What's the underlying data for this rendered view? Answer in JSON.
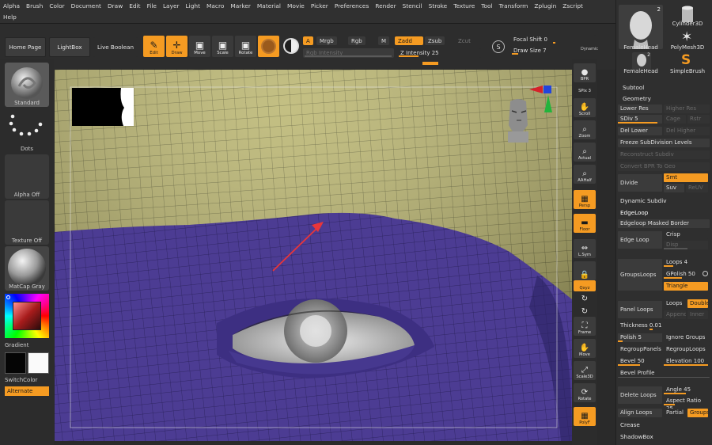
{
  "menu": {
    "row1": [
      "Alpha",
      "Brush",
      "Color",
      "Document",
      "Draw",
      "Edit",
      "File",
      "Layer",
      "Light",
      "Macro",
      "Marker",
      "Material",
      "Movie",
      "Picker",
      "Preferences",
      "Render",
      "Stencil",
      "Stroke",
      "Texture",
      "Tool",
      "Transform",
      "Zplugin",
      "Zscript"
    ],
    "row2": "Help"
  },
  "topshelf": {
    "home_page": "Home Page",
    "lightbox": "LightBox",
    "live_boolean": "Live Boolean",
    "tools": [
      {
        "label": "Edit",
        "icon": "edit-icon",
        "glyph": "✎",
        "active": true
      },
      {
        "label": "Draw",
        "icon": "draw-icon",
        "glyph": "✛",
        "active": true
      },
      {
        "label": "Move",
        "icon": "move-icon",
        "glyph": "▣",
        "active": false
      },
      {
        "label": "Scale",
        "icon": "scale-icon",
        "glyph": "▣",
        "active": false
      },
      {
        "label": "Rotate",
        "icon": "rotate-icon",
        "glyph": "▣",
        "active": false
      }
    ],
    "a_label": "A",
    "mrgb": "Mrgb",
    "rgb": "Rgb",
    "m": "M",
    "zadd": "Zadd",
    "zsub": "Zsub",
    "zcut": "Zcut",
    "rgb_intensity": "Rgb Intensity",
    "z_intensity": "Z Intensity 25",
    "z_intensity_value": 25,
    "focal_shift": "Focal Shift 0",
    "draw_size": "Draw Size 7",
    "dynamic": "Dynamic",
    "s_label": "S"
  },
  "leftshelf": {
    "standard": "Standard",
    "dots": "Dots",
    "alpha_off": "Alpha Off",
    "texture_off": "Texture Off",
    "matcap": "MatCap Gray",
    "gradient": "Gradient",
    "switchcolor": "SwitchColor",
    "alternate": "Alternate"
  },
  "viewbar": [
    {
      "label": "BPR",
      "icon": "bpr-icon",
      "glyph": "●",
      "active": false
    },
    {
      "label": "SPix 3",
      "icon": "spix-icon",
      "glyph": "",
      "active": false
    },
    {
      "label": "Scroll",
      "icon": "scroll-icon",
      "glyph": "✋",
      "active": false
    },
    {
      "label": "Zoom",
      "icon": "zoom-icon",
      "glyph": "⌕",
      "active": false
    },
    {
      "label": "Actual",
      "icon": "actual-icon",
      "glyph": "⌕",
      "active": false
    },
    {
      "label": "AAHalf",
      "icon": "aahalf-icon",
      "glyph": "⌕",
      "active": false
    },
    {
      "label": "Persp",
      "icon": "persp-icon",
      "glyph": "▦",
      "active": true
    },
    {
      "label": "Floor",
      "icon": "floor-icon",
      "glyph": "▬",
      "active": true
    },
    {
      "label": "L.Sym",
      "icon": "lsym-icon",
      "glyph": "⇔",
      "active": false
    },
    {
      "label": "",
      "icon": "lock-icon",
      "glyph": "🔒",
      "active": false
    },
    {
      "label": "Qxyz",
      "icon": "xyz-icon",
      "glyph": "",
      "active": true
    },
    {
      "label": "",
      "icon": "rotate-y-icon",
      "glyph": "↻",
      "active": false
    },
    {
      "label": "",
      "icon": "rotate-z-icon",
      "glyph": "↻",
      "active": false
    },
    {
      "label": "Frame",
      "icon": "frame-icon",
      "glyph": "⛶",
      "active": false
    },
    {
      "label": "Move",
      "icon": "move-view-icon",
      "glyph": "✋",
      "active": false
    },
    {
      "label": "Scale3D",
      "icon": "scale3d-icon",
      "glyph": "⤢",
      "active": false
    },
    {
      "label": "Rotate",
      "icon": "rotate-view-icon",
      "glyph": "⟳",
      "active": false
    },
    {
      "label": "PolyF",
      "icon": "polyframe-icon",
      "glyph": "▦",
      "active": true
    }
  ],
  "rightpanel": {
    "thumbs": [
      {
        "label": "FemaleHead",
        "badge": "2",
        "icon": "female-head-thumb"
      },
      {
        "label": "Cylinder3D",
        "badge": "",
        "icon": "cylinder-thumb"
      },
      {
        "label": "FemaleHead",
        "badge": "2",
        "icon": "female-head-thumb-small"
      },
      {
        "label": "PolyMesh3D",
        "badge": "",
        "icon": "polymesh-star-thumb"
      },
      {
        "label": "",
        "badge": "",
        "icon": "spacer"
      },
      {
        "label": "SimpleBrush",
        "badge": "",
        "icon": "simplebrush-thumb"
      }
    ],
    "subtool": "Subtool",
    "geometry": "Geometry",
    "lower_res": "Lower Res",
    "higher_res": "Higher Res",
    "sdiv": "SDiv 5",
    "sdiv_value": 5,
    "cage": "Cage",
    "rstr": "Rstr",
    "del_lower": "Del Lower",
    "del_higher": "Del Higher",
    "freeze": "Freeze SubDivision Levels",
    "reconstruct": "Reconstruct Subdiv",
    "convert_bpr": "Convert BPR To Geo",
    "divide": "Divide",
    "smt": "Smt",
    "suv": "Suv",
    "reuv": "ReUV",
    "dynamic_subdiv": "Dynamic Subdiv",
    "edgeloop": "EdgeLoop",
    "edgeloop_masked": "Edgeloop Masked Border",
    "edge_loop": "Edge Loop",
    "crisp": "Crisp",
    "disp": "Disp",
    "groupsloops": "GroupsLoops",
    "loops": "Loops 4",
    "loops_value": 4,
    "gpolish": "GPolish 50",
    "gpolish_value": 50,
    "triangle": "Triangle",
    "panel_loops": "Panel Loops",
    "loops2": "Loops",
    "double": "Double",
    "append": "Append",
    "inner": "Inner",
    "thickness": "Thickness 0.01",
    "thickness_value": 0.01,
    "polish": "Polish 5",
    "polish_value": 5,
    "ignore_groups": "Ignore Groups",
    "regroup_panels": "RegroupPanels",
    "regroup_loops": "RegroupLoops",
    "bevel": "Bevel 50",
    "bevel_value": 50,
    "elevation": "Elevation 100",
    "elevation_value": 100,
    "bevel_profile": "Bevel Profile",
    "delete_loops": "Delete Loops",
    "angle": "Angle 45",
    "angle_value": 45,
    "aspect_ratio": "Aspect Ratio 25",
    "aspect_value": 25,
    "align_loops": "Align Loops",
    "partial": "Partial",
    "groups": "Groups",
    "crease": "Crease",
    "shadowbox": "ShadowBox"
  },
  "colors": {
    "accent": "#f59b22",
    "mesh_yellow": "#b9b46d",
    "mesh_purple": "#5745a8",
    "arrow_red": "#e8353a"
  }
}
